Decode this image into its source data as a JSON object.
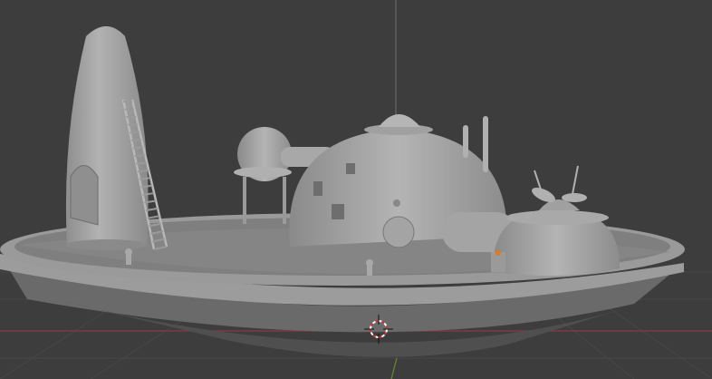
{
  "viewport": {
    "background": "#3d3d3d",
    "grid_color": "#474747",
    "x_axis_color": "#8a3a40",
    "y_axis_color": "#6b8a2a",
    "model_color": "#a6a6a6",
    "model_shadow": "#7e7e7e",
    "selection_marker_color": "#e07a1f"
  },
  "icons": {
    "cursor": "3d-cursor-icon"
  }
}
